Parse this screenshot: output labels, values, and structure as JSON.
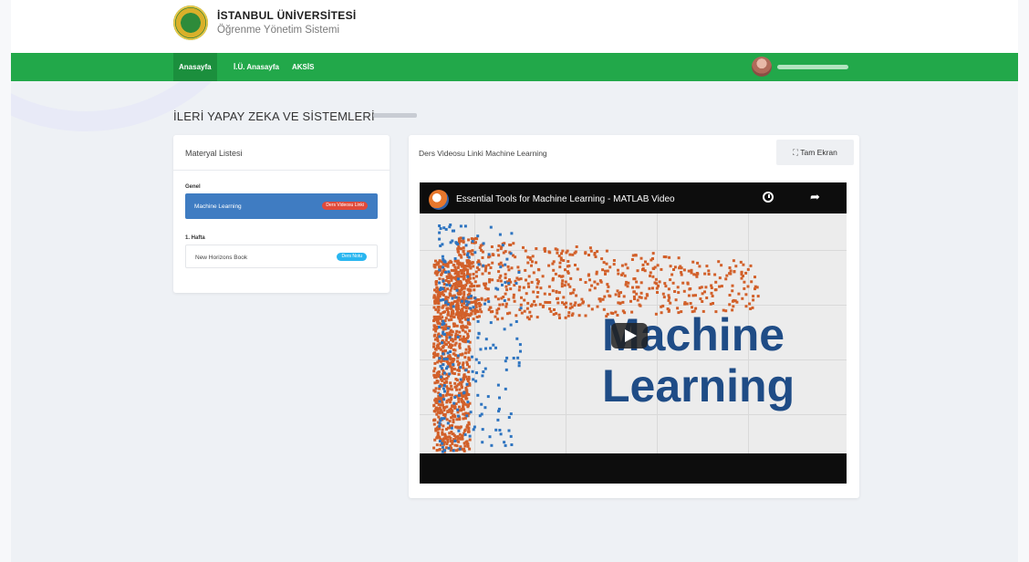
{
  "header": {
    "university": "İSTANBUL ÜNİVERSİTESİ",
    "system": "Öğrenme Yönetim Sistemi"
  },
  "nav": {
    "items": [
      "Anasayfa",
      "İ.Ü. Anasayfa",
      "AKSİS"
    ],
    "active": "Anasayfa"
  },
  "course": {
    "title": "İLERİ YAPAY ZEKA VE SİSTEMLERİ"
  },
  "material_list": {
    "title": "Materyal Listesi",
    "sections": [
      {
        "label": "Genel",
        "items": [
          {
            "label": "Machine Learning",
            "badge": "Ders Videosu Linki",
            "badge_color": "#e04a3a",
            "active": true
          }
        ]
      },
      {
        "label": "1. Hafta",
        "items": [
          {
            "label": "New Horizons Book",
            "badge": "Ders Notu",
            "badge_color": "#29b6f0",
            "active": false
          }
        ]
      }
    ]
  },
  "viewer": {
    "title": "Ders Videosu Linki Machine Learning",
    "fullscreen_label": "Tam Ekran",
    "video_title": "Essential Tools for Machine Learning - MATLAB Video",
    "overlay_line1": "Machine",
    "overlay_line2": "Learning"
  },
  "colors": {
    "nav_green": "#22a84a",
    "active_item_blue": "#3f7cc2",
    "scatter_orange": "#d2602a",
    "scatter_blue": "#2e74c0",
    "overlay_text": "#1f4c86"
  }
}
